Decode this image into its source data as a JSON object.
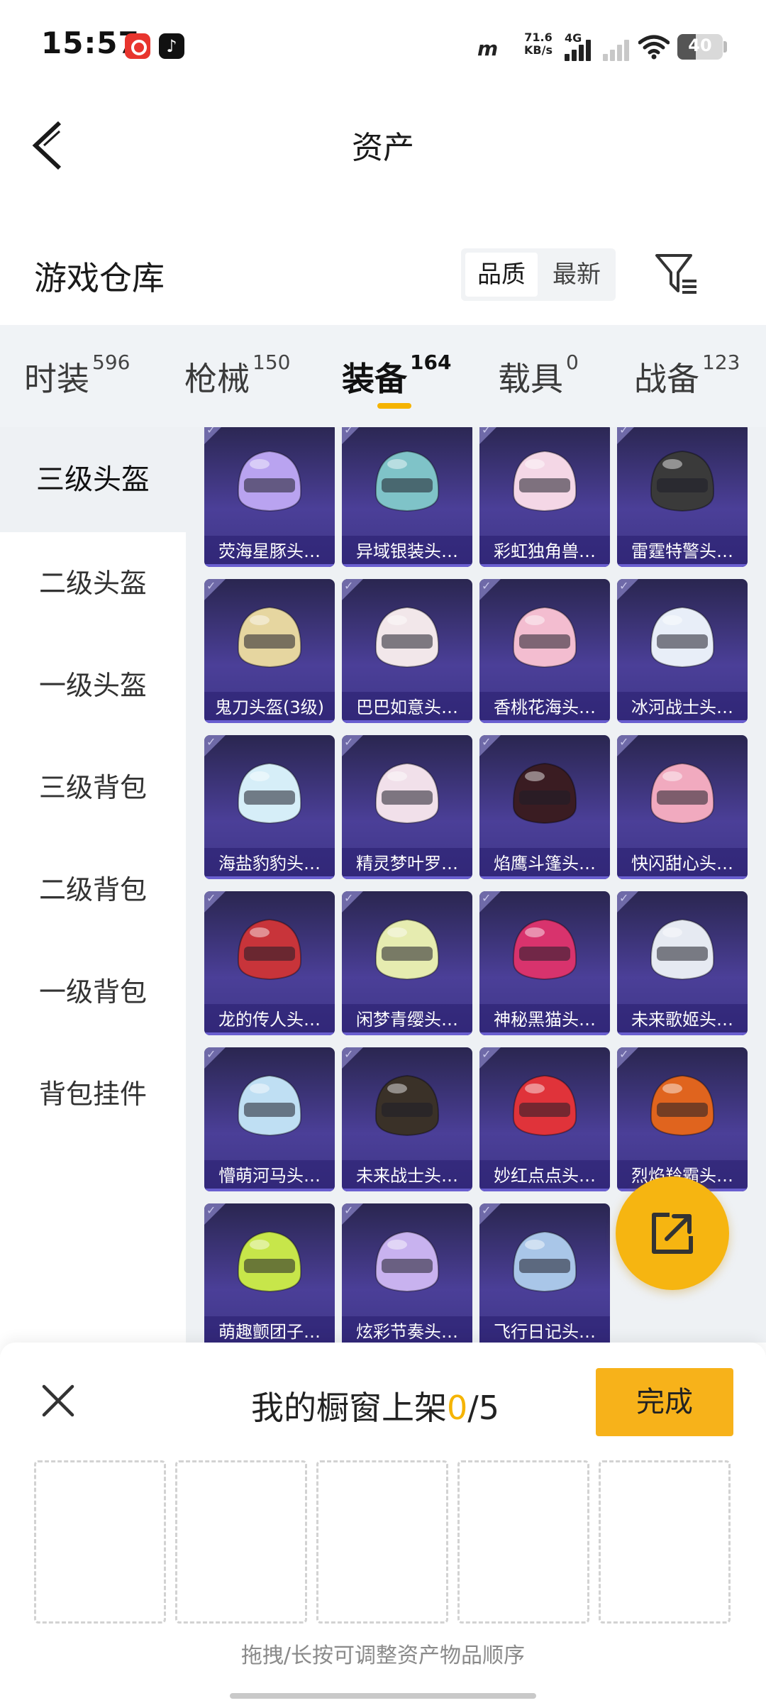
{
  "status_bar": {
    "time": "15:57",
    "net_brand": "m",
    "net_speed_value": "71.6",
    "net_speed_unit": "KB/s",
    "network_type": "4G",
    "battery": "40",
    "battery_level": 0.4,
    "icons": [
      "netease-cloud-music-icon",
      "tiktok-icon",
      "signal-icon",
      "wifi-icon",
      "battery-icon"
    ]
  },
  "header": {
    "title": "资产",
    "back_icon": "chevron-left-icon"
  },
  "warehouse": {
    "title": "游戏仓库",
    "sort_options": [
      "品质",
      "最新"
    ],
    "sort_selected": "品质",
    "filter_icon": "filter-icon"
  },
  "tabs": [
    {
      "label": "时装",
      "count": "596"
    },
    {
      "label": "枪械",
      "count": "150"
    },
    {
      "label": "装备",
      "count": "164"
    },
    {
      "label": "载具",
      "count": "0"
    },
    {
      "label": "战备",
      "count": "123"
    }
  ],
  "active_tab": "装备",
  "sidebar": {
    "items": [
      "三级头盔",
      "二级头盔",
      "一级头盔",
      "三级背包",
      "二级背包",
      "一级背包",
      "背包挂件"
    ],
    "active": "三级头盔"
  },
  "items": [
    {
      "label": "荧海星豚头…",
      "color": "#b9a3f0"
    },
    {
      "label": "异域银装头…",
      "color": "#7fc3c8"
    },
    {
      "label": "彩虹独角兽…",
      "color": "#f4d7e6"
    },
    {
      "label": "雷霆特警头…",
      "color": "#3a3a3a"
    },
    {
      "label": "鬼刀头盔(3级)",
      "color": "#e6d6a0"
    },
    {
      "label": "巴巴如意头…",
      "color": "#f2e7ea"
    },
    {
      "label": "香桃花海头…",
      "color": "#f3bdd0"
    },
    {
      "label": "冰河战士头…",
      "color": "#e8eef8"
    },
    {
      "label": "海盐豹豹头…",
      "color": "#d6eef8"
    },
    {
      "label": "精灵梦叶罗…",
      "color": "#f1e0ea"
    },
    {
      "label": "焰鹰斗篷头…",
      "color": "#3a1c22"
    },
    {
      "label": "快闪甜心头…",
      "color": "#f1aabf"
    },
    {
      "label": "龙的传人头…",
      "color": "#c8343a"
    },
    {
      "label": "闲梦青缨头…",
      "color": "#e6ecb0"
    },
    {
      "label": "神秘黑猫头…",
      "color": "#d8336d"
    },
    {
      "label": "未来歌姬头…",
      "color": "#e6eaf2"
    },
    {
      "label": "懵萌河马头…",
      "color": "#bfdff3"
    },
    {
      "label": "未来战士头…",
      "color": "#3a3128"
    },
    {
      "label": "妙红点点头…",
      "color": "#e0333a"
    },
    {
      "label": "烈焰羚霸头…",
      "color": "#e0641e"
    },
    {
      "label": "萌趣颤团子…",
      "color": "#c7e64a"
    },
    {
      "label": "炫彩节奏头…",
      "color": "#c8b2ef"
    },
    {
      "label": "飞行日记头…",
      "color": "#a9c6e8"
    }
  ],
  "share_button": {
    "icon": "share-external-icon"
  },
  "sheet": {
    "close_icon": "close-icon",
    "title_prefix": "我的橱窗上架",
    "count_current": "0",
    "count_total": "/5",
    "done_label": "完成",
    "slot_count": 5,
    "hint": "拖拽/长按可调整资产物品顺序"
  },
  "colors": {
    "accent": "#f5b300",
    "card_gradient_top": "#2a2650",
    "card_gradient_bottom": "#4b3f98",
    "tabs_background": "#f0f3f6"
  }
}
